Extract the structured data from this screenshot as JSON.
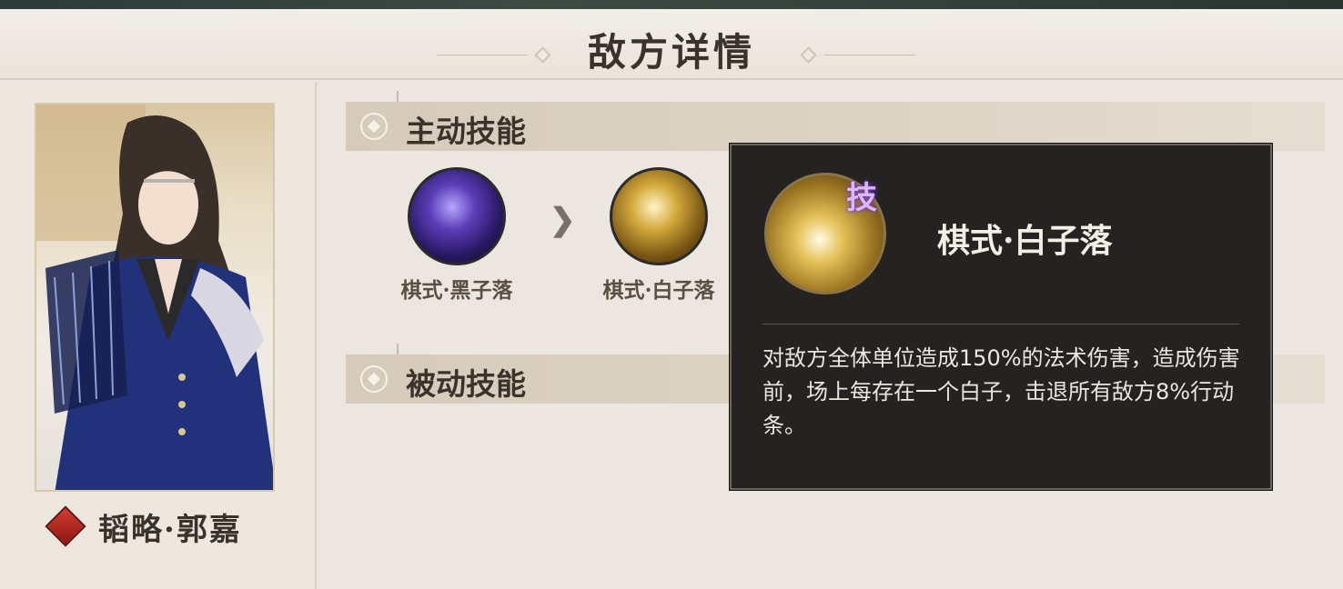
{
  "header": {
    "title": "敌方详情"
  },
  "character": {
    "name": "韬略·郭嘉"
  },
  "active_section": {
    "label": "主动技能"
  },
  "passive_section": {
    "label": "被动技能"
  },
  "skills": [
    {
      "name": "棋式·黑子落"
    },
    {
      "name": "棋式·白子落"
    }
  ],
  "tooltip": {
    "badge": "技",
    "title": "棋式·白子落",
    "description": "对敌方全体单位造成150%的法术伤害，造成伤害前，场上每存在一个白子，击退所有敌方8%行动条。"
  },
  "colors": {
    "background": "#ebe6df",
    "section_bar": "#d6cbbb",
    "tooltip_bg": "#242322",
    "badge_purple": "#d9b8ff",
    "badge_red": "#d43a2e"
  }
}
